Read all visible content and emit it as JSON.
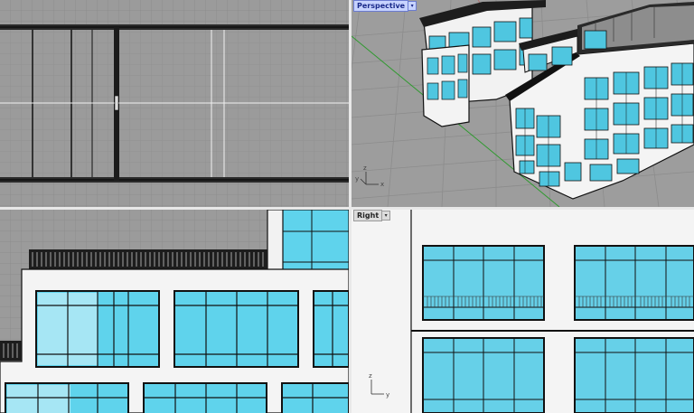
{
  "viewports": {
    "top": {
      "label": ""
    },
    "perspective": {
      "label": "Perspective"
    },
    "front": {
      "label": ""
    },
    "right": {
      "label": "Right"
    }
  },
  "axis": {
    "x": "x",
    "y": "y",
    "z": "z"
  },
  "icons": {
    "dropdown": "chevron-down-icon"
  },
  "colors": {
    "background_grid": "#9b9b9b",
    "grid_line": "#8a8a8a",
    "glass": "#5fd3ec",
    "glass_light": "#a6e6f4",
    "wall": "#f4f4f4",
    "edge": "#111111",
    "active_tag": "#c7d3ff",
    "x_axis": "#b44",
    "y_axis": "#2a9a2a",
    "border": "#e8e8e8"
  }
}
